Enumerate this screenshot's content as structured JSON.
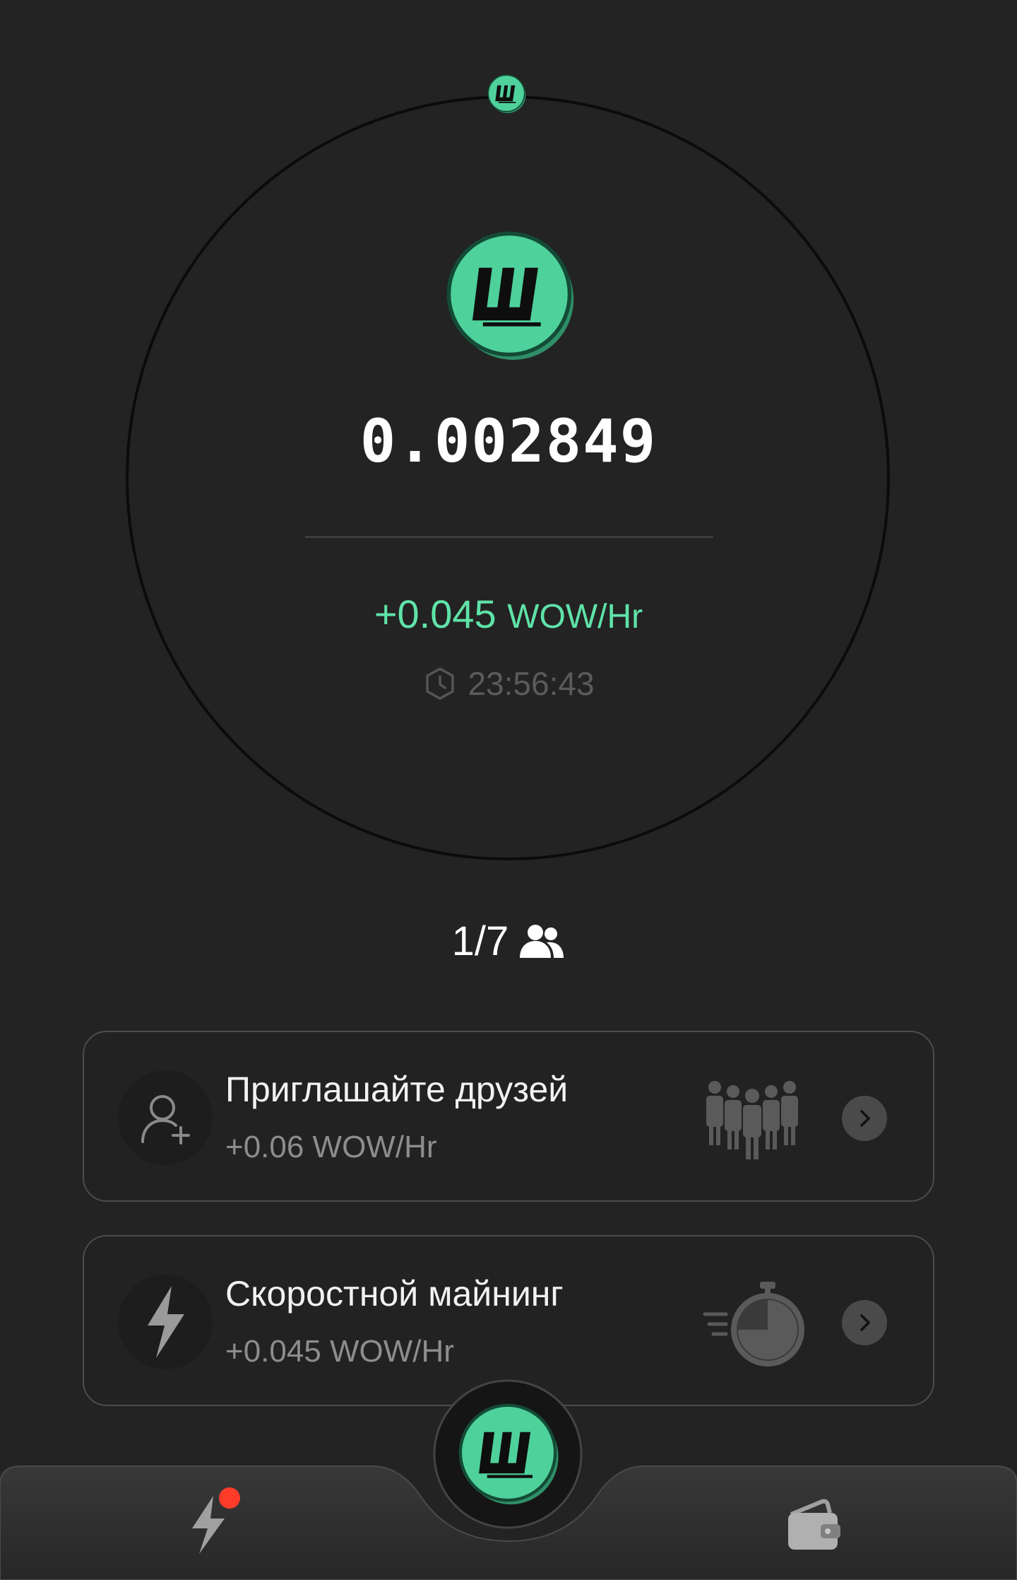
{
  "mining": {
    "balance": "0.002849",
    "rate_value": "+0.045",
    "rate_unit": "WOW/Hr",
    "timer": "23:56:43"
  },
  "friends": {
    "count": "1/7"
  },
  "cards": [
    {
      "title": "Приглашайте друзей",
      "subtitle": "+0.06 WOW/Hr",
      "icon": "add-user-icon",
      "art": "team-icon"
    },
    {
      "title": "Скоростной майнинг",
      "subtitle": "+0.045 WOW/Hr",
      "icon": "lightning-icon",
      "art": "stopwatch-icon"
    }
  ],
  "nav": {
    "items": [
      "boost-icon",
      "wow-coin-icon",
      "wallet-icon"
    ],
    "notification": true
  },
  "colors": {
    "background": "#232323",
    "accent": "#5fe3a8",
    "coin": "#4fd19b",
    "notification": "#ff3b2a"
  }
}
